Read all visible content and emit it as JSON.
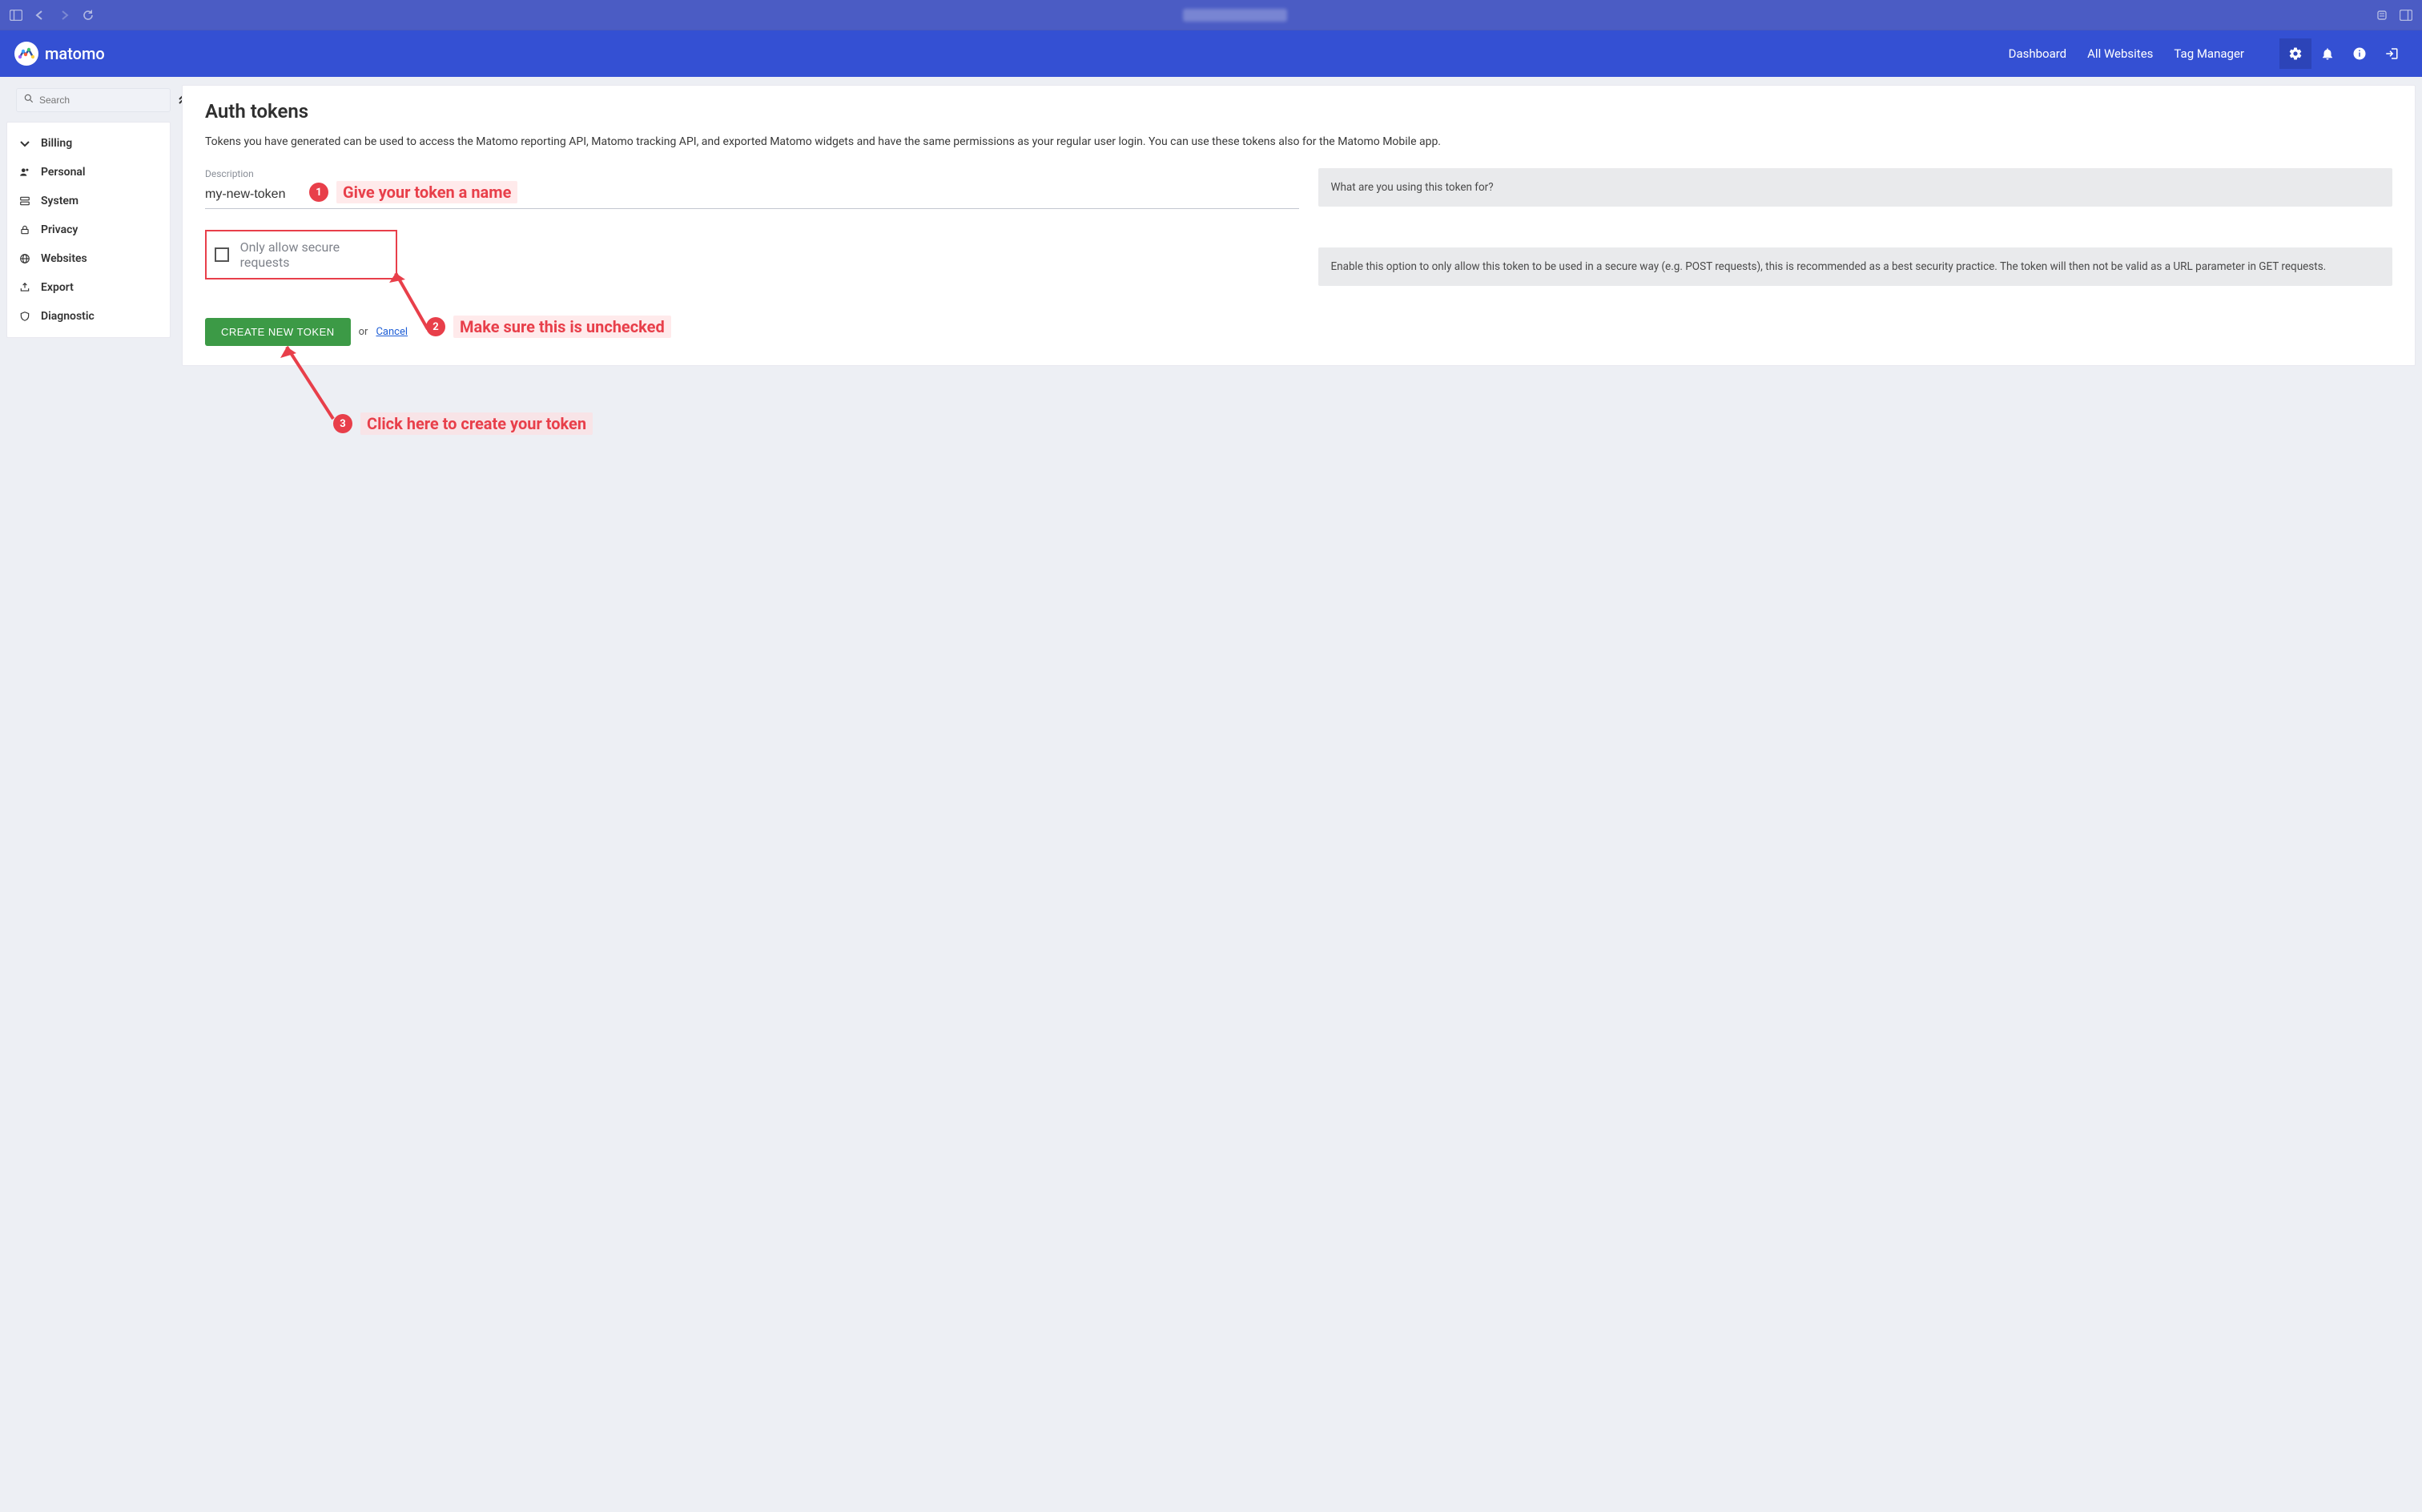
{
  "browser": {},
  "brand": "matomo",
  "nav": {
    "dashboard": "Dashboard",
    "allwebsites": "All Websites",
    "tagmanager": "Tag Manager"
  },
  "search": {
    "placeholder": "Search"
  },
  "sidebar": {
    "items": [
      {
        "label": "Billing"
      },
      {
        "label": "Personal"
      },
      {
        "label": "System"
      },
      {
        "label": "Privacy"
      },
      {
        "label": "Websites"
      },
      {
        "label": "Export"
      },
      {
        "label": "Diagnostic"
      }
    ]
  },
  "page": {
    "title": "Auth tokens",
    "intro": "Tokens you have generated can be used to access the Matomo reporting API, Matomo tracking API, and exported Matomo widgets and have the same permissions as your regular user login. You can use these tokens also for the Matomo Mobile app.",
    "description_label": "Description",
    "description_value": "my-new-token",
    "description_help": "What are you using this token for?",
    "secure_checkbox_label": "Only allow secure requests",
    "secure_help": "Enable this option to only allow this token to be used in a secure way (e.g. POST requests), this is recommended as a best security practice. The token will then not be valid as a URL parameter in GET requests.",
    "create_button": "CREATE NEW TOKEN",
    "or": "or",
    "cancel": "Cancel"
  },
  "annotations": {
    "a1_num": "1",
    "a1_text": "Give your token a name",
    "a2_num": "2",
    "a2_text": "Make sure this is unchecked",
    "a3_num": "3",
    "a3_text": "Click here to create your token"
  }
}
